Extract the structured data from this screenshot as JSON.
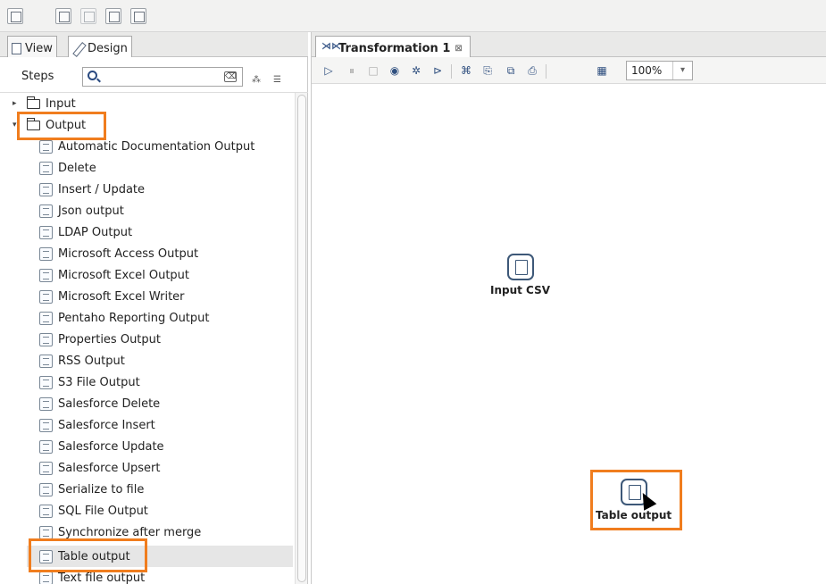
{
  "left_tabs": {
    "view": "View",
    "design": "Design"
  },
  "steps": {
    "label": "Steps",
    "search_placeholder": ""
  },
  "tree": {
    "folders": [
      {
        "label": "Input",
        "expanded": false
      },
      {
        "label": "Output",
        "expanded": true
      }
    ],
    "output_items": [
      "Automatic Documentation Output",
      "Delete",
      "Insert / Update",
      "Json output",
      "LDAP Output",
      "Microsoft Access Output",
      "Microsoft Excel Output",
      "Microsoft Excel Writer",
      "Pentaho Reporting Output",
      "Properties Output",
      "RSS Output",
      "S3 File Output",
      "Salesforce Delete",
      "Salesforce Insert",
      "Salesforce Update",
      "Salesforce Upsert",
      "Serialize to file",
      "SQL File Output",
      "Synchronize after merge",
      "Table output",
      "Text file output"
    ]
  },
  "editor_tab": {
    "title": "Transformation 1",
    "close_glyph": "⊠"
  },
  "zoom": {
    "value": "100%"
  },
  "canvas": {
    "nodes": [
      {
        "label": "Input CSV"
      },
      {
        "label": "Table output"
      }
    ]
  },
  "colors": {
    "highlight": "#f07d1e",
    "icon": "#3d5878",
    "selected_bg": "#e6e6e6"
  }
}
